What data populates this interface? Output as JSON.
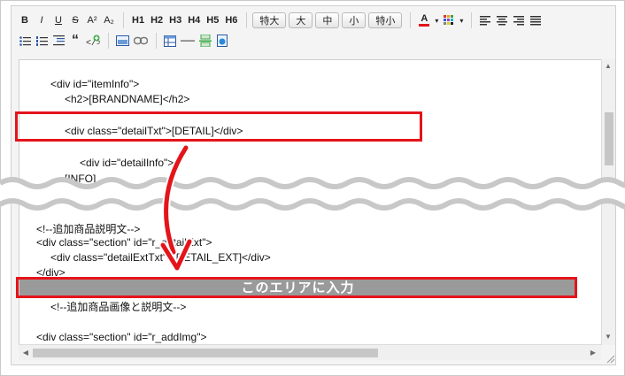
{
  "toolbar": {
    "row1": {
      "format": [
        "B",
        "I",
        "U",
        "S",
        "A²",
        "A₂"
      ],
      "headings": [
        "H1",
        "H2",
        "H3",
        "H4",
        "H5",
        "H6"
      ],
      "sizes": [
        "特大",
        "大",
        "中",
        "小",
        "特小"
      ],
      "font_color_label": "A"
    },
    "row2": {
      "quote": "“"
    }
  },
  "code_lines": [
    "<div id=\"itemInfo\">",
    "<h2>[BRANDNAME]</h2>",
    "<div class=\"detailTxt\">[DETAIL]</div>",
    "<div id=\"detailInfo\">",
    "[INFO]",
    "<!--追加商品説明文-->",
    "<div class=\"section\" id=\"r_detailExt\">",
    "<div class=\"detailExtTxt\">[DETAIL_EXT]</div>",
    "</div>",
    "<!--追加商品画像と説明文-->",
    "<div class=\"section\" id=\"r_addImg\">"
  ],
  "annotation": {
    "banner_text": "このエリアに入力"
  },
  "colors": {
    "highlight_red": "#e4141a",
    "wave_gray": "#c8c8c8",
    "banner_gray": "#9a9a9a"
  }
}
